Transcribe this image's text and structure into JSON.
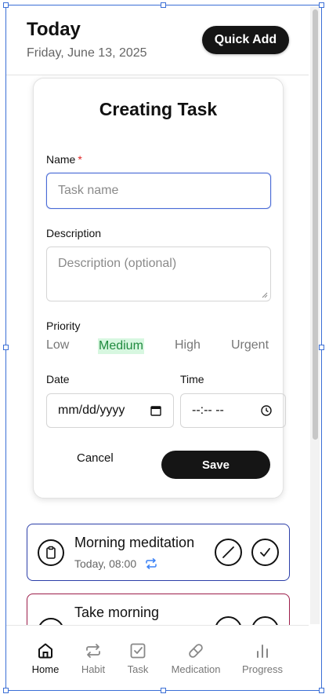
{
  "header": {
    "title": "Today",
    "date": "Friday, June 13, 2025",
    "quick_add_label": "Quick Add"
  },
  "modal": {
    "title": "Creating Task",
    "name_label": "Name",
    "required_mark": "*",
    "name_placeholder": "Task name",
    "description_label": "Description",
    "description_placeholder": "Description (optional)",
    "priority_label": "Priority",
    "priorities": [
      "Low",
      "Medium",
      "High",
      "Urgent"
    ],
    "selected_priority": "Medium",
    "date_label": "Date",
    "date_placeholder": "mm/dd/yyyy",
    "time_label": "Time",
    "time_placeholder": "--:-- --",
    "cancel_label": "Cancel",
    "save_label": "Save"
  },
  "tasks": [
    {
      "title": "Morning meditation",
      "meta": "Today, 08:00",
      "border_color": "#2b3ea8",
      "icon": "clipboard-icon"
    },
    {
      "title": "Take morning",
      "meta": "",
      "border_color": "#9c1d4a",
      "icon": "clipboard-icon"
    }
  ],
  "nav": {
    "items": [
      {
        "label": "Home",
        "icon": "home-icon"
      },
      {
        "label": "Habit",
        "icon": "repeat-icon"
      },
      {
        "label": "Task",
        "icon": "checkbox-icon"
      },
      {
        "label": "Medication",
        "icon": "pill-icon"
      },
      {
        "label": "Progress",
        "icon": "bar-chart-icon"
      }
    ],
    "active": "Home"
  },
  "colors": {
    "accent": "#151515",
    "selection": "#3b6fd6",
    "priority_selected_bg": "#d7f7e0",
    "priority_selected_text": "#1f8a3e",
    "required": "#e02424"
  }
}
